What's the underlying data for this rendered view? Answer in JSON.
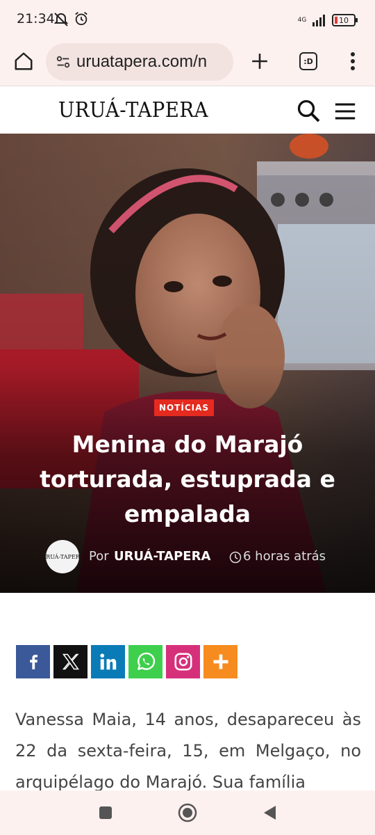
{
  "status_bar": {
    "time": "21:34",
    "network": "4G",
    "battery": "10",
    "icons": [
      "mute-icon",
      "alarm-icon",
      "signal-icon",
      "battery-icon"
    ]
  },
  "browser": {
    "url": "uruatapera.com/n",
    "tab_count_label": ":D",
    "icons": [
      "home-icon",
      "site-settings-icon",
      "new-tab-icon",
      "tabs-icon",
      "more-icon"
    ]
  },
  "site": {
    "logo": "URUÁ-TAPERA",
    "icons": [
      "search-icon",
      "hamburger-menu-icon"
    ]
  },
  "article": {
    "category": "NOTÍCIAS",
    "title": "Menina do Marajó torturada, estuprada e empalada",
    "byline_prefix": "Por",
    "author": "URUÁ-TAPERA",
    "avatar_logo": "URUÁ-TAPERA",
    "time_ago": "6 horas atrás",
    "body": "Vanessa Maia, 14 anos, desapareceu às 22 da sexta-feira, 15, em Melgaço, no arquipélago do Marajó. Sua família"
  },
  "share": {
    "buttons": [
      {
        "name": "facebook",
        "color": "#3b5998"
      },
      {
        "name": "x",
        "color": "#111111"
      },
      {
        "name": "linkedin",
        "color": "#0a7bb6"
      },
      {
        "name": "whatsapp",
        "color": "#3ecf4c"
      },
      {
        "name": "instagram",
        "color": "#d6307a"
      },
      {
        "name": "more",
        "color": "#f68b1f"
      }
    ]
  },
  "nav": {
    "icons": [
      "recents-square-icon",
      "home-circle-icon",
      "back-triangle-icon"
    ]
  }
}
